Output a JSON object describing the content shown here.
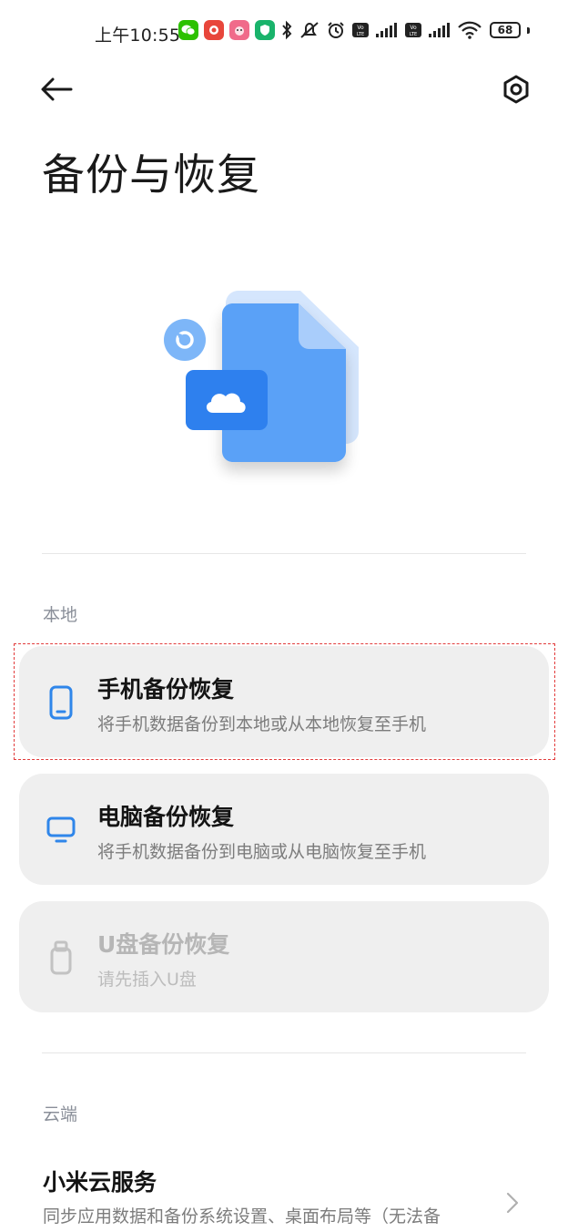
{
  "status_bar": {
    "time": "上午10:55",
    "battery": "68",
    "icons": [
      "wechat-icon",
      "app-icon",
      "app-icon",
      "app-icon",
      "bluetooth-icon",
      "mute-icon",
      "alarm-icon",
      "volte-icon",
      "signal-icon",
      "volte-icon",
      "signal-icon",
      "wifi-icon",
      "battery-icon"
    ]
  },
  "header": {
    "back_icon": "arrow-left-icon",
    "settings_icon": "gear-icon",
    "title": "备份与恢复"
  },
  "hero": {
    "illustration": "file-cloud-backup-illustration",
    "colors": {
      "primary": "#3b8cf5",
      "light": "#9cc6fb"
    }
  },
  "local_section": {
    "label": "本地",
    "items": [
      {
        "title": "手机备份恢复",
        "subtitle": "将手机数据备份到本地或从本地恢复至手机",
        "icon": "phone-icon",
        "enabled": true
      },
      {
        "title": "电脑备份恢复",
        "subtitle": "将手机数据备份到电脑或从电脑恢复至手机",
        "icon": "monitor-icon",
        "enabled": true
      },
      {
        "title": "U盘备份恢复",
        "subtitle": "请先插入U盘",
        "icon": "usb-drive-icon",
        "enabled": false
      }
    ]
  },
  "cloud_section": {
    "label": "云端",
    "item": {
      "title": "小米云服务",
      "description": "同步应用数据和备份系统设置、桌面布局等（无法备",
      "icon": "chevron-right-icon"
    }
  },
  "colors": {
    "accent": "#2f86ea",
    "card_bg": "#efefef",
    "disabled": "#b6b6b6",
    "highlight": "#e23b3b"
  }
}
